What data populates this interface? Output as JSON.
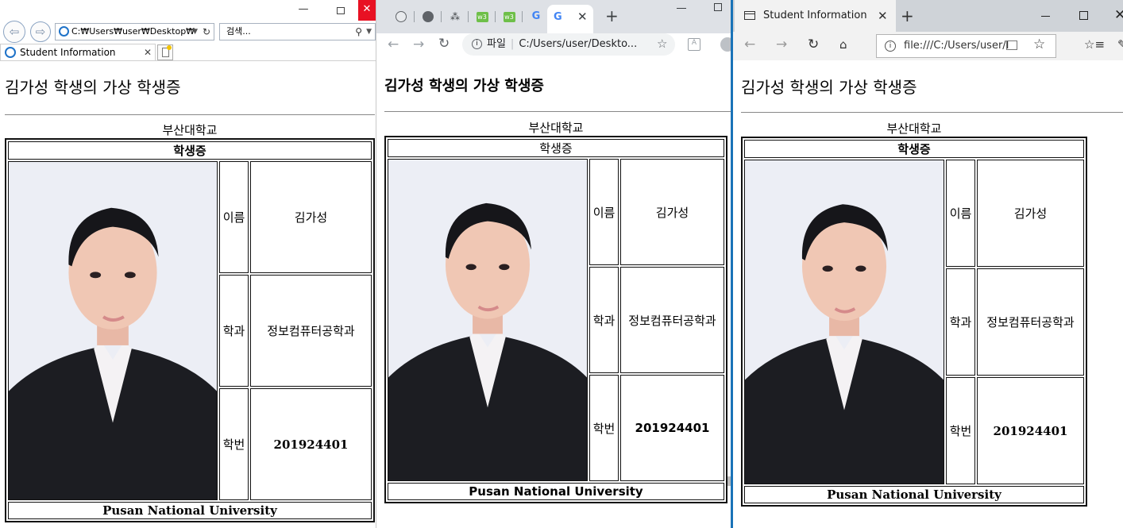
{
  "ie": {
    "address": "C:₩Users₩user₩Desktop₩",
    "search_placeholder": "검색...",
    "tab_title": "Student Information",
    "min_icon": "minimize-icon",
    "close_icon": "close-icon"
  },
  "chrome": {
    "address_scheme": "파일",
    "address": "C:/Users/user/Deskto...",
    "active_tab_icon": "google-icon"
  },
  "edge": {
    "tab_title": "Student Information",
    "address": "file:///C:/Users/user/I"
  },
  "page": {
    "heading": "김가성 학생의 가상 학생증",
    "university": "부산대학교",
    "card_title": "학생증",
    "photo_alt": "student-photo",
    "rows": [
      {
        "label": "이름",
        "value": "김가성"
      },
      {
        "label": "학과",
        "value": "정보컴퓨터공학과"
      },
      {
        "label": "학번",
        "value": "201924401"
      }
    ],
    "footer": "Pusan National University"
  },
  "colors": {
    "ie_close": "#e81123",
    "chrome_frame": "#dee1e6",
    "edge_accent": "#1a73b8"
  }
}
